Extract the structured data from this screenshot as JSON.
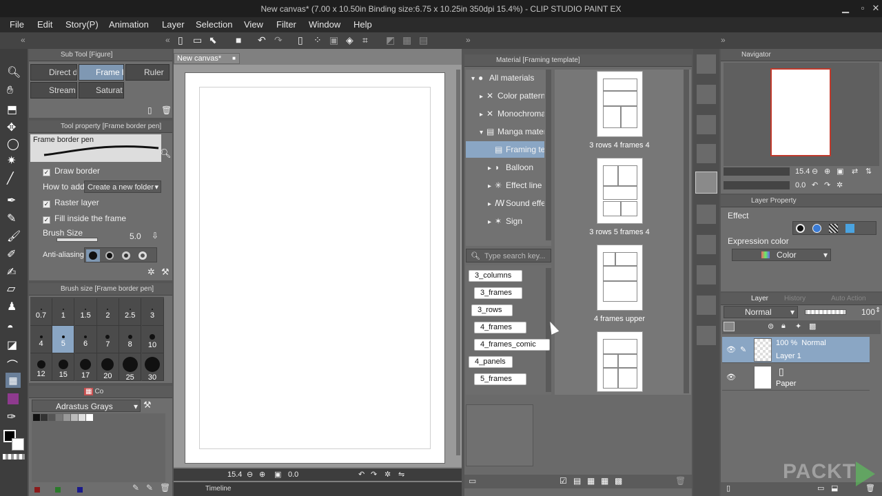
{
  "window": {
    "title": "New canvas* (7.00 x 10.50in Binding size:6.75 x 10.25in 350dpi 15.4%) - CLIP STUDIO PAINT EX"
  },
  "menu": [
    "File",
    "Edit",
    "Story(P)",
    "Animation",
    "Layer",
    "Selection",
    "View",
    "Filter",
    "Window",
    "Help"
  ],
  "subtool": {
    "header": "Sub Tool [Figure]",
    "items": [
      "Direct dr",
      "Frame b",
      "Ruler",
      "Stream",
      "Saturat"
    ]
  },
  "tool_property": {
    "header": "Tool property [Frame border pen]",
    "preview_label": "Frame border pen",
    "draw_border": "Draw border",
    "how_to_add_label": "How to add",
    "how_to_add_value": "Create a new folder",
    "raster_layer": "Raster layer",
    "fill_inside": "Fill inside the frame",
    "brush_size_label": "Brush Size",
    "brush_size_value": "5.0",
    "antialias_label": "Anti-aliasing"
  },
  "brush_size": {
    "header": "Brush size [Frame border pen]",
    "sizes": [
      "0.7",
      "1",
      "1.5",
      "2",
      "2.5",
      "3",
      "4",
      "5",
      "6",
      "7",
      "8",
      "10",
      "12",
      "15",
      "17",
      "20",
      "25",
      "30"
    ]
  },
  "color_set": {
    "tab_label": "Co",
    "set_name": "Adrastus Grays"
  },
  "canvas": {
    "tab": "New canvas*",
    "zoom": "15.4",
    "angle": "0.0",
    "timeline_label": "Timeline"
  },
  "material": {
    "header": "Material [Framing template]",
    "tree": [
      "All materials",
      "Color pattern",
      "Monochroma",
      "Manga mater",
      "Framing ter",
      "Balloon",
      "Effect line",
      "Sound effec",
      "Sign"
    ],
    "search_placeholder": "Type search key...",
    "tags": [
      "3_columns",
      "3_frames",
      "3_rows",
      "4_frames",
      "4_frames_comic",
      "4_panels",
      "5_frames"
    ],
    "templates": [
      "3 rows 4 frames 4",
      "3 rows 5 frames 4",
      "4 frames upper"
    ]
  },
  "navigator": {
    "header": "Navigator",
    "zoom": "15.4",
    "angle": "0.0"
  },
  "layer_property": {
    "header": "Layer Property",
    "effect_label": "Effect",
    "expression_label": "Expression color",
    "expression_value": "Color"
  },
  "layer": {
    "tabs": [
      "Layer",
      "History",
      "Auto Action"
    ],
    "blend_mode": "Normal",
    "opacity": "100",
    "layers": [
      {
        "meta": "100 %  Normal",
        "name": "Layer 1"
      },
      {
        "meta": "",
        "name": "Paper"
      }
    ]
  },
  "watermark": "PACKT",
  "colors": {
    "accent": "#c0392b",
    "selected": "#8aa6c4"
  }
}
